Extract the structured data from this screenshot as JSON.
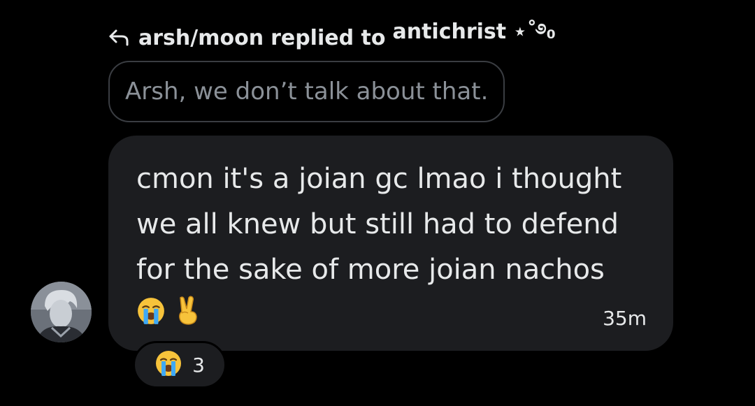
{
  "reply": {
    "author": "arsh/moon",
    "verb": "replied to",
    "target": "antichrist ⋆˚࿔₀",
    "quoted_text": "Arsh, we don’t talk about that."
  },
  "message": {
    "text": "cmon it's a joian gc lmao i thought we all knew but still had to defend for the sake of more joian nachos",
    "emojis": [
      "loudly-crying-face",
      "victory-hand"
    ],
    "timestamp": "35m"
  },
  "reaction": {
    "emoji": "loudly-crying-face",
    "count": "3"
  },
  "colors": {
    "background": "#000000",
    "bubble": "#1c1d20",
    "text": "#e7e9ea",
    "muted": "#8b9198",
    "border": "#3a3d42"
  }
}
